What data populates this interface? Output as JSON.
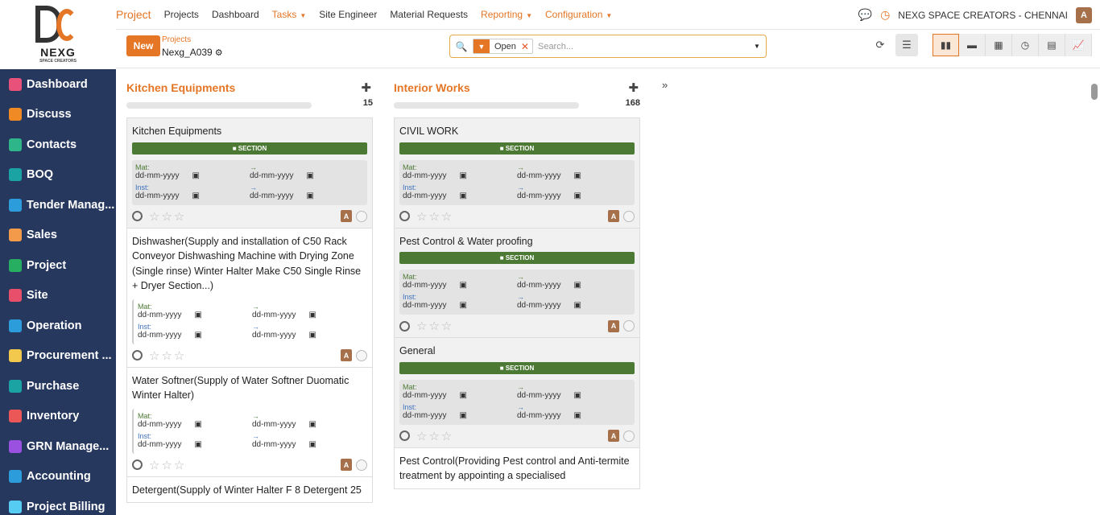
{
  "logo": {
    "brand": "NEXG",
    "tagline": "SPACE CREATORS"
  },
  "sidebar": {
    "items": [
      {
        "label": "Dashboard",
        "icon": "dashboard-icon",
        "color": "#e8517a"
      },
      {
        "label": "Discuss",
        "icon": "discuss-icon",
        "color": "#f08a24"
      },
      {
        "label": "Contacts",
        "icon": "contacts-icon",
        "color": "#2fb58a"
      },
      {
        "label": "BOQ",
        "icon": "boq-icon",
        "color": "#1ba3a3"
      },
      {
        "label": "Tender Manag...",
        "icon": "tender-icon",
        "color": "#2d9cdb"
      },
      {
        "label": "Sales",
        "icon": "sales-icon",
        "color": "#f2994a"
      },
      {
        "label": "Project",
        "icon": "project-icon",
        "color": "#27ae60"
      },
      {
        "label": "Site",
        "icon": "site-icon",
        "color": "#e84f6b"
      },
      {
        "label": "Operation",
        "icon": "operation-icon",
        "color": "#2d9cdb"
      },
      {
        "label": "Procurement ...",
        "icon": "procurement-icon",
        "color": "#f2c94c"
      },
      {
        "label": "Purchase",
        "icon": "purchase-icon",
        "color": "#1ba3a3"
      },
      {
        "label": "Inventory",
        "icon": "inventory-icon",
        "color": "#eb5757"
      },
      {
        "label": "GRN Manage...",
        "icon": "grn-icon",
        "color": "#9b51e0"
      },
      {
        "label": "Accounting",
        "icon": "accounting-icon",
        "color": "#2d9cdb"
      },
      {
        "label": "Project Billing",
        "icon": "billing-icon",
        "color": "#56ccf2"
      }
    ]
  },
  "topbar": {
    "app": "Project",
    "menu": [
      {
        "label": "Projects",
        "dd": false
      },
      {
        "label": "Dashboard",
        "dd": false
      },
      {
        "label": "Tasks",
        "dd": true
      },
      {
        "label": "Site Engineer",
        "dd": false
      },
      {
        "label": "Material Requests",
        "dd": false
      },
      {
        "label": "Reporting",
        "dd": true
      },
      {
        "label": "Configuration",
        "dd": true
      }
    ],
    "company": "NEXG SPACE CREATORS - CHENNAI",
    "avatar": "A"
  },
  "subbar": {
    "new_label": "New",
    "breadcrumb_parent": "Projects",
    "breadcrumb_current": "Nexg_A039"
  },
  "search": {
    "facet": "Open",
    "placeholder": "Search..."
  },
  "columns": [
    {
      "title": "Kitchen Equipments",
      "count": "15",
      "cards": [
        {
          "title": "Kitchen Equipments",
          "section": true
        },
        {
          "title": "Dishwasher(Supply and installation of C50 Rack Conveyor Dishwashing Machine with Drying Zone (Single rinse) Winter Halter Make C50 Single Rinse + Dryer Section...)",
          "section": false
        },
        {
          "title": "Water Softner(Supply of Water Softner Duomatic Winter Halter)",
          "section": false
        },
        {
          "title": "Detergent(Supply of Winter Halter F 8 Detergent 25",
          "section": false
        }
      ]
    },
    {
      "title": "Interior Works",
      "count": "168",
      "cards": [
        {
          "title": "CIVIL WORK",
          "section": true
        },
        {
          "title": "Pest Control & Water proofing",
          "section": true
        },
        {
          "title": "General",
          "section": true
        },
        {
          "title": "Pest Control(Providing Pest control and Anti-termite treatment by appointing a specialised",
          "section": false
        }
      ]
    }
  ],
  "labels": {
    "section": "■ SECTION",
    "mat": "Mat:",
    "inst": "Inst:",
    "arrow": "→",
    "date_placeholder": "dd-mm-yyyy",
    "assignee": "A"
  }
}
